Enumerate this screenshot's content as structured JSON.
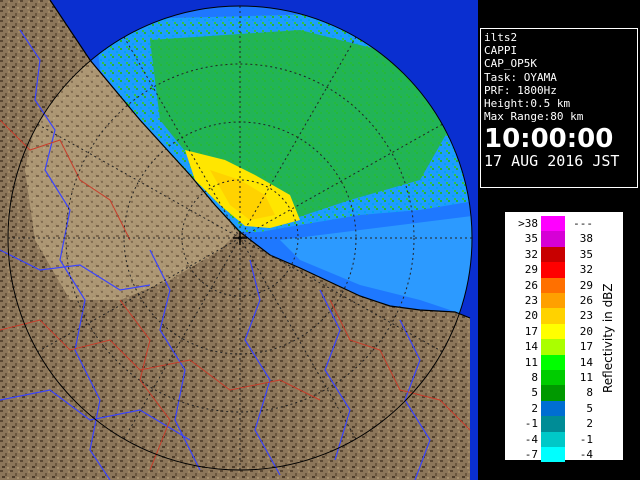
{
  "info_panel": {
    "lines": [
      "ilts2",
      "CAPPI",
      "CAP_OP5K",
      "Task: OYAMA",
      "PRF: 1800Hz",
      "Height:0.5 km",
      "Max Range:80 km"
    ],
    "time": "10:00:00",
    "date": "17 AUG 2016 JST"
  },
  "legend": {
    "title": "Reflectivity in dBZ",
    "rows": [
      {
        "lo": ">38",
        "hi": "---",
        "color": "#ff00ff"
      },
      {
        "lo": "35",
        "hi": "38",
        "color": "#d600d6"
      },
      {
        "lo": "32",
        "hi": "35",
        "color": "#c80000"
      },
      {
        "lo": "29",
        "hi": "32",
        "color": "#ff0000"
      },
      {
        "lo": "26",
        "hi": "29",
        "color": "#ff7000"
      },
      {
        "lo": "23",
        "hi": "26",
        "color": "#ffa000"
      },
      {
        "lo": "20",
        "hi": "23",
        "color": "#ffd200"
      },
      {
        "lo": "17",
        "hi": "20",
        "color": "#ffff00"
      },
      {
        "lo": "14",
        "hi": "17",
        "color": "#aaff00"
      },
      {
        "lo": "11",
        "hi": "14",
        "color": "#00ff00"
      },
      {
        "lo": "8",
        "hi": "11",
        "color": "#00cc00"
      },
      {
        "lo": "5",
        "hi": "8",
        "color": "#009900"
      },
      {
        "lo": "2",
        "hi": "5",
        "color": "#006ed2"
      },
      {
        "lo": "-1",
        "hi": "2",
        "color": "#008c96"
      },
      {
        "lo": "-4",
        "hi": "-1",
        "color": "#00c8c8"
      },
      {
        "lo": "-7",
        "hi": "-4",
        "color": "#00ffff"
      }
    ]
  },
  "colors": {
    "sea": "#0a2fd0",
    "land": "#8a7458",
    "land_dark": "#5e4a34",
    "echo_light": "#1e8cff",
    "echo_green": "#22bb22",
    "echo_yellow": "#ffe600",
    "river": "#3a44ff",
    "border": "#c83c2a"
  }
}
